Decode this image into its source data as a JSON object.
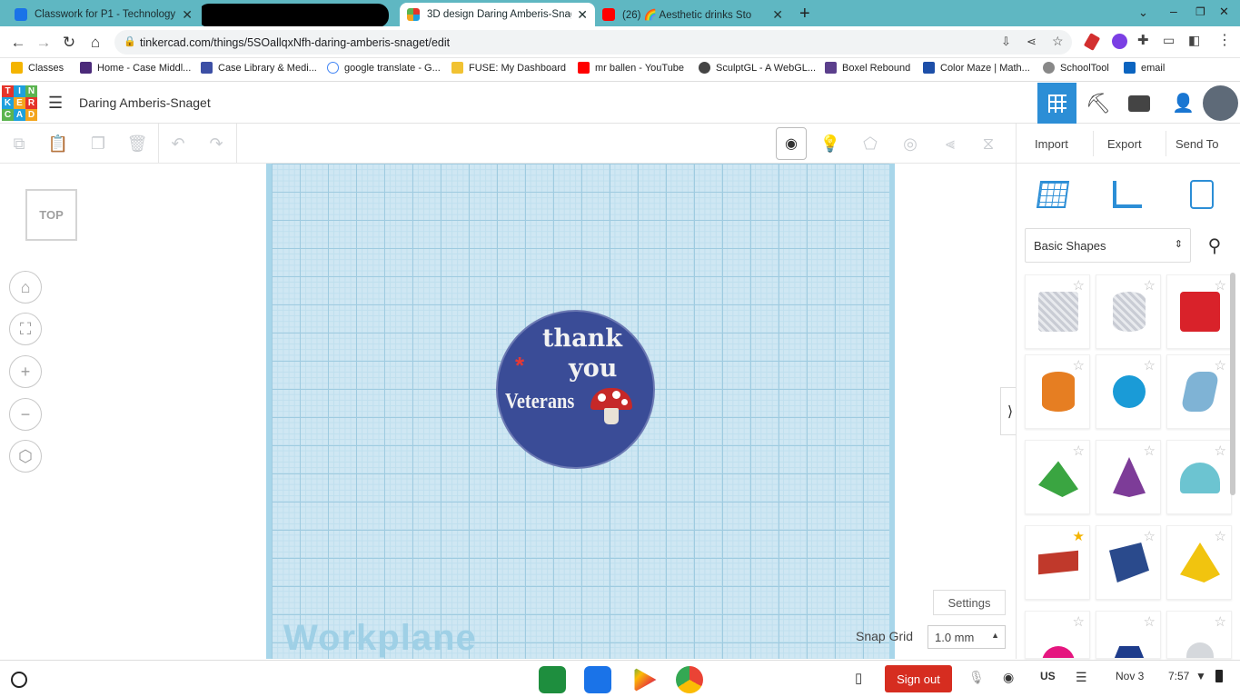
{
  "browser": {
    "tabs": [
      {
        "title": "Classwork for P1 - Technology - ",
        "favicon_color": "#1a73e8"
      },
      {
        "title": "",
        "favicon_color": "#000000"
      },
      {
        "title": "3D design Daring Amberis-Snag",
        "favicon_color": "#e5342a"
      },
      {
        "title": "(26) 🌈 Aesthetic drinks Sto",
        "favicon_color": "#ff0000"
      }
    ],
    "url": "tinkercad.com/things/5SOallqxNfh-daring-amberis-snaget/edit",
    "bookmarks": [
      "Classes",
      "Home - Case Middl...",
      "Case Library & Medi...",
      "google translate - G...",
      "FUSE: My Dashboard",
      "mr ballen - YouTube",
      "SculptGL - A WebGL...",
      "Boxel Rebound",
      "Color Maze | Math...",
      "SchoolTool",
      "email"
    ]
  },
  "tinkercad": {
    "logo_letters": [
      "T",
      "I",
      "N",
      "K",
      "E",
      "R",
      "C",
      "A",
      "D"
    ],
    "design_title": "Daring Amberis-Snaget",
    "toolbar": {
      "import": "Import",
      "export": "Export",
      "send_to": "Send To"
    },
    "view_cube": "TOP",
    "workplane_label": "Workplane",
    "disc_text": {
      "line1": "thank",
      "line2": "you",
      "line3": "Veterans"
    },
    "settings": "Settings",
    "snap_grid_label": "Snap Grid",
    "snap_grid_value": "1.0 mm",
    "shape_category": "Basic Shapes"
  },
  "shapes": [
    {
      "name": "box-hole",
      "color": "#b8bcc7"
    },
    {
      "name": "cylinder-hole",
      "color": "#b8bcc7"
    },
    {
      "name": "box",
      "color": "#d9222a"
    },
    {
      "name": "cylinder",
      "color": "#e67e22"
    },
    {
      "name": "sphere",
      "color": "#1a9bd7"
    },
    {
      "name": "scribble",
      "color": "#7fb3d5"
    },
    {
      "name": "roof",
      "color": "#3aa541"
    },
    {
      "name": "cone",
      "color": "#7d3c98"
    },
    {
      "name": "round-roof",
      "color": "#6cc4d1"
    },
    {
      "name": "text",
      "color": "#c0392b",
      "favorite": true
    },
    {
      "name": "shape-generator",
      "color": "#2a4a8c"
    },
    {
      "name": "pyramid",
      "color": "#f1c40f"
    },
    {
      "name": "half-sphere",
      "color": "#e5167f"
    },
    {
      "name": "polygon",
      "color": "#1e3c8c"
    },
    {
      "name": "paraboloid",
      "color": "#d5d8dc"
    }
  ],
  "shelf": {
    "sign_out": "Sign out",
    "lang": "US",
    "date": "Nov 3",
    "time": "7:57"
  }
}
